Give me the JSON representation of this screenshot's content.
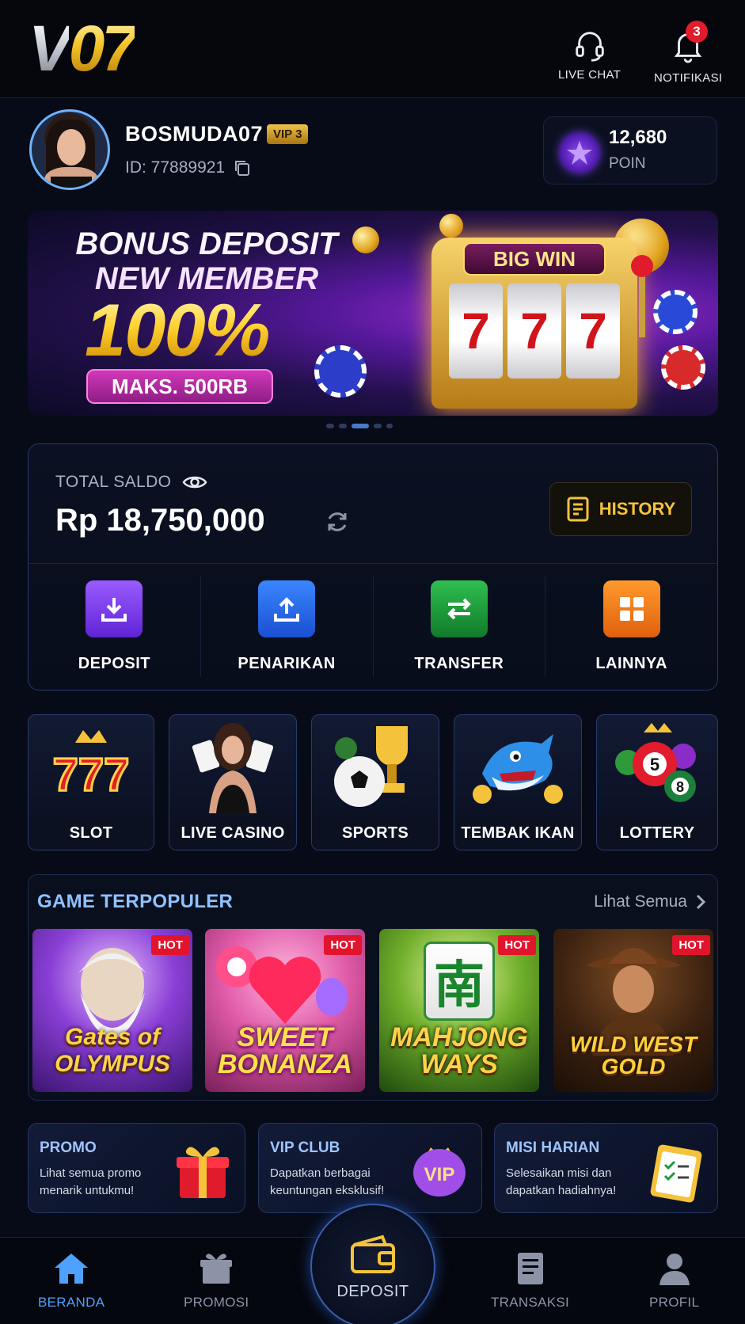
{
  "header": {
    "logo": "V07",
    "live_chat": "LIVE CHAT",
    "notifications": "NOTIFIKASI",
    "notification_count": "3"
  },
  "profile": {
    "username": "BOSMUDA07",
    "vip": "VIP 3",
    "id": "ID: 77889921",
    "points_value": "12,680",
    "points_label": "POIN"
  },
  "banner": {
    "line1": "BONUS DEPOSIT",
    "line2": "NEW MEMBER",
    "percent": "100%",
    "max": "MAKS. 500RB",
    "machine_label": "BIG WIN",
    "reel": "7",
    "active_slide": 3,
    "slide_count": 5
  },
  "balance": {
    "label": "TOTAL SALDO",
    "amount": "Rp 18,750,000",
    "history": "HISTORY",
    "actions": [
      {
        "label": "DEPOSIT",
        "icon": "download-icon",
        "color": "#7b3df0"
      },
      {
        "label": "PENARIKAN",
        "icon": "upload-icon",
        "color": "#2a6ef2"
      },
      {
        "label": "TRANSFER",
        "icon": "transfer-icon",
        "color": "#1e9a3a"
      },
      {
        "label": "LAINNYA",
        "icon": "grid-icon",
        "color": "#f07a1c"
      }
    ]
  },
  "categories": [
    {
      "label": "SLOT",
      "icon": "slot-777-icon"
    },
    {
      "label": "LIVE CASINO",
      "icon": "live-dealer-icon"
    },
    {
      "label": "SPORTS",
      "icon": "trophy-icon"
    },
    {
      "label": "TEMBAK IKAN",
      "icon": "shark-icon"
    },
    {
      "label": "LOTTERY",
      "icon": "lottery-balls-icon"
    }
  ],
  "popular": {
    "title": "GAME TERPOPULER",
    "see_all": "Lihat Semua",
    "hot": "HOT",
    "games": [
      {
        "name": "Gates of OLYMPUS"
      },
      {
        "name": "SWEET BONANZA"
      },
      {
        "name": "MAHJONG WAYS",
        "tile": "南"
      },
      {
        "name": "WILD WEST GOLD"
      }
    ]
  },
  "features": [
    {
      "title": "PROMO",
      "desc": "Lihat semua promo menarik untukmu!",
      "icon": "gift-icon"
    },
    {
      "title": "VIP CLUB",
      "desc": "Dapatkan berbagai keuntungan eksklusif!",
      "icon": "vip-crown-icon"
    },
    {
      "title": "MISI HARIAN",
      "desc": "Selesaikan misi dan dapatkan hadiahnya!",
      "icon": "clipboard-icon"
    }
  ],
  "nav": {
    "home": "BERANDA",
    "promo": "PROMOSI",
    "deposit": "DEPOSIT",
    "transactions": "TRANSAKSI",
    "profile": "PROFIL"
  },
  "colors": {
    "accent": "#4ea1ff",
    "gold": "#f5c33b",
    "hot": "#e1142c",
    "background": "#070b17"
  }
}
